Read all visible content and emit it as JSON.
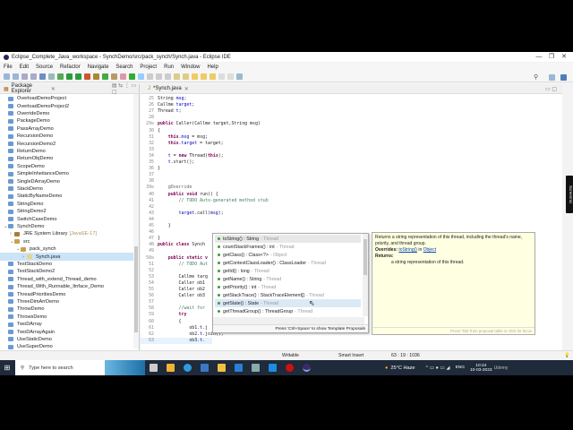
{
  "window": {
    "title": "Eclipse_Complete_Java_workspace - SynchDemo/src/pack_synch/Synch.java - Eclipse IDE",
    "minimize": "—",
    "restore": "❐",
    "close": "✕"
  },
  "menu": [
    "File",
    "Edit",
    "Source",
    "Refactor",
    "Navigate",
    "Search",
    "Project",
    "Run",
    "Window",
    "Help"
  ],
  "package_explorer": {
    "title": "Package Explorer",
    "items": [
      {
        "label": "OverloadDemoProject",
        "type": "project"
      },
      {
        "label": "OverloadDemoProject2",
        "type": "project"
      },
      {
        "label": "OverrideDemo",
        "type": "project"
      },
      {
        "label": "PackageDemo",
        "type": "project"
      },
      {
        "label": "PassArrayDemo",
        "type": "project"
      },
      {
        "label": "RecursionDemo",
        "type": "project"
      },
      {
        "label": "RecursionDemo2",
        "type": "project"
      },
      {
        "label": "ReturnDemo",
        "type": "project"
      },
      {
        "label": "ReturnObjDemo",
        "type": "project"
      },
      {
        "label": "ScopeDemo",
        "type": "project"
      },
      {
        "label": "SimpleInheitanceDemo",
        "type": "project"
      },
      {
        "label": "SingleDArrayDemo",
        "type": "project"
      },
      {
        "label": "StackDemo",
        "type": "project"
      },
      {
        "label": "StaticByNameDemo",
        "type": "project"
      },
      {
        "label": "StringDemo",
        "type": "project"
      },
      {
        "label": "StringDemo2",
        "type": "project"
      },
      {
        "label": "SwitchCaseDemo",
        "type": "project"
      },
      {
        "label": "SynchDemo",
        "type": "open",
        "indent": 0,
        "arrow": "v"
      },
      {
        "label": "JRE System Library",
        "extra": "[JavaSE-17]",
        "type": "lib",
        "indent": 1,
        "arrow": ">"
      },
      {
        "label": "src",
        "type": "src",
        "indent": 1,
        "arrow": "v"
      },
      {
        "label": "pack_synch",
        "type": "pkg",
        "indent": 2,
        "arrow": "v"
      },
      {
        "label": "Synch.java",
        "type": "file",
        "indent": 3,
        "arrow": ">",
        "selected": true
      },
      {
        "label": "TestStackDemo",
        "type": "project"
      },
      {
        "label": "TestStackDemo2",
        "type": "project"
      },
      {
        "label": "Thread_with_extend_Thread_demo",
        "type": "project"
      },
      {
        "label": "Thread_With_Runnable_Itnface_Demo",
        "type": "project"
      },
      {
        "label": "ThreadPrioritiesDemo",
        "type": "project"
      },
      {
        "label": "ThreeDimArrDemo",
        "type": "project"
      },
      {
        "label": "ThrowDemo",
        "type": "project"
      },
      {
        "label": "ThrowsDemo",
        "type": "project"
      },
      {
        "label": "TwoDArray",
        "type": "project"
      },
      {
        "label": "TwoDArrayAgain",
        "type": "project"
      },
      {
        "label": "UseStaticDemo",
        "type": "project"
      },
      {
        "label": "UseSuperDemo",
        "type": "project"
      }
    ]
  },
  "editor": {
    "tab": "*Synch.java",
    "lines": [
      {
        "n": "25",
        "s": [
          [
            "p",
            "String "
          ],
          [
            "f",
            "msg"
          ],
          [
            "p",
            ";"
          ]
        ]
      },
      {
        "n": "26",
        "s": [
          [
            "p",
            "Callme "
          ],
          [
            "f",
            "target"
          ],
          [
            "p",
            ";"
          ]
        ]
      },
      {
        "n": "27",
        "s": [
          [
            "p",
            "Thread "
          ],
          [
            "f",
            "t"
          ],
          [
            "p",
            ";"
          ]
        ]
      },
      {
        "n": "28",
        "s": []
      },
      {
        "n": "29⊖",
        "s": [
          [
            "k",
            "public "
          ],
          [
            "p",
            "Caller(Callme target,String msg)"
          ]
        ]
      },
      {
        "n": "30",
        "s": [
          [
            "p",
            "{"
          ]
        ]
      },
      {
        "n": "31",
        "s": [
          [
            "k",
            "    this"
          ],
          [
            "p",
            "."
          ],
          [
            "f",
            "msg"
          ],
          [
            "p",
            " = msg;"
          ]
        ]
      },
      {
        "n": "32",
        "s": [
          [
            "k",
            "    this"
          ],
          [
            "p",
            "."
          ],
          [
            "f",
            "target"
          ],
          [
            "p",
            " = target;"
          ]
        ]
      },
      {
        "n": "33",
        "s": []
      },
      {
        "n": "34",
        "s": [
          [
            "p",
            "    "
          ],
          [
            "f",
            "t"
          ],
          [
            "p",
            " = "
          ],
          [
            "k",
            "new "
          ],
          [
            "p",
            "Thread("
          ],
          [
            "k",
            "this"
          ],
          [
            "p",
            ");"
          ]
        ]
      },
      {
        "n": "35",
        "s": [
          [
            "p",
            "    "
          ],
          [
            "f",
            "t"
          ],
          [
            "p",
            ".start();"
          ]
        ]
      },
      {
        "n": "36",
        "s": [
          [
            "p",
            "}"
          ]
        ]
      },
      {
        "n": "37",
        "s": []
      },
      {
        "n": "38",
        "s": []
      },
      {
        "n": "39⊖",
        "s": [
          [
            "a",
            "    @Override"
          ]
        ]
      },
      {
        "n": "40",
        "s": [
          [
            "k",
            "    public void "
          ],
          [
            "p",
            "run() {"
          ]
        ]
      },
      {
        "n": "41",
        "s": [
          [
            "c",
            "        // TODO Auto-generated method stub"
          ]
        ]
      },
      {
        "n": "42",
        "s": []
      },
      {
        "n": "43",
        "s": [
          [
            "p",
            "        "
          ],
          [
            "f",
            "target"
          ],
          [
            "p",
            ".call("
          ],
          [
            "f",
            "msg"
          ],
          [
            "p",
            ");"
          ]
        ]
      },
      {
        "n": "44",
        "s": []
      },
      {
        "n": "45",
        "s": [
          [
            "p",
            "    }"
          ]
        ]
      },
      {
        "n": "46",
        "s": []
      },
      {
        "n": "47",
        "s": [
          [
            "p",
            "}"
          ]
        ]
      },
      {
        "n": "48",
        "s": [
          [
            "k",
            "public class "
          ],
          [
            "p",
            "Synch"
          ]
        ]
      },
      {
        "n": "49",
        "s": []
      },
      {
        "n": "50⊖",
        "s": [
          [
            "k",
            "    public static v"
          ]
        ]
      },
      {
        "n": "51",
        "s": [
          [
            "c",
            "        // TODO Aut"
          ]
        ]
      },
      {
        "n": "52",
        "s": []
      },
      {
        "n": "53",
        "s": [
          [
            "p",
            "        Callme targ"
          ]
        ]
      },
      {
        "n": "54",
        "s": [
          [
            "p",
            "        Caller ob1"
          ]
        ]
      },
      {
        "n": "55",
        "s": [
          [
            "p",
            "        Caller ob2"
          ]
        ]
      },
      {
        "n": "56",
        "s": [
          [
            "p",
            "        Caller ob3"
          ]
        ]
      },
      {
        "n": "57",
        "s": []
      },
      {
        "n": "58",
        "s": [
          [
            "c",
            "        //wait for"
          ]
        ]
      },
      {
        "n": "59",
        "s": [
          [
            "k",
            "        try"
          ]
        ]
      },
      {
        "n": "60",
        "s": [
          [
            "p",
            "        {"
          ]
        ]
      },
      {
        "n": "61",
        "s": [
          [
            "p",
            "            ob1."
          ],
          [
            "f",
            "t"
          ],
          [
            "p",
            ".j"
          ]
        ]
      },
      {
        "n": "62",
        "s": [
          [
            "p",
            "            ob2."
          ],
          [
            "f",
            "t"
          ],
          [
            "p",
            ".join();"
          ]
        ]
      },
      {
        "n": "63",
        "s": [
          [
            "p",
            "            ob3."
          ],
          [
            "f",
            "t"
          ],
          [
            "p",
            "."
          ]
        ]
      }
    ]
  },
  "completion": {
    "items": [
      {
        "name": "toString() : String",
        "cls": "- Thread",
        "selected": true
      },
      {
        "name": "countStackFrames() : int",
        "cls": "- Thread"
      },
      {
        "name": "getClass() : Class<?>",
        "cls": "- Object"
      },
      {
        "name": "getContextClassLoader() : ClassLoader",
        "cls": "- Thread"
      },
      {
        "name": "getId() : long",
        "cls": "- Thread"
      },
      {
        "name": "getName() : String",
        "cls": "- Thread"
      },
      {
        "name": "getPriority() : int",
        "cls": "- Thread"
      },
      {
        "name": "getStackTrace() : StackTraceElement[]",
        "cls": "- Thread"
      },
      {
        "name": "getState() : State",
        "cls": "- Thread",
        "hover": true
      },
      {
        "name": "getThreadGroup() : ThreadGroup",
        "cls": "- Thread"
      }
    ],
    "footer": "Press 'Ctrl+Space' to show Template Proposals"
  },
  "javadoc": {
    "description": "Returns a string representation of this thread, including the thread's name, priority, and thread group.",
    "overrides_label": "Overrides:",
    "overrides_method": "toString()",
    "overrides_in": "in",
    "overrides_class": "Object",
    "returns_label": "Returns:",
    "returns_text": "a string representation of this thread.",
    "footer": "Press 'Tab' from proposal table or click for focus"
  },
  "side_badge": "Screenmc",
  "status": {
    "writable": "Writable",
    "insert": "Smart Insert",
    "position": "63 : 19 : 1036"
  },
  "taskbar": {
    "search_placeholder": "Type here to search",
    "weather": "25°C  Haze",
    "lang": "ENG",
    "time": "10:24",
    "date": "10-03-2023",
    "watermark": "Udemy"
  }
}
